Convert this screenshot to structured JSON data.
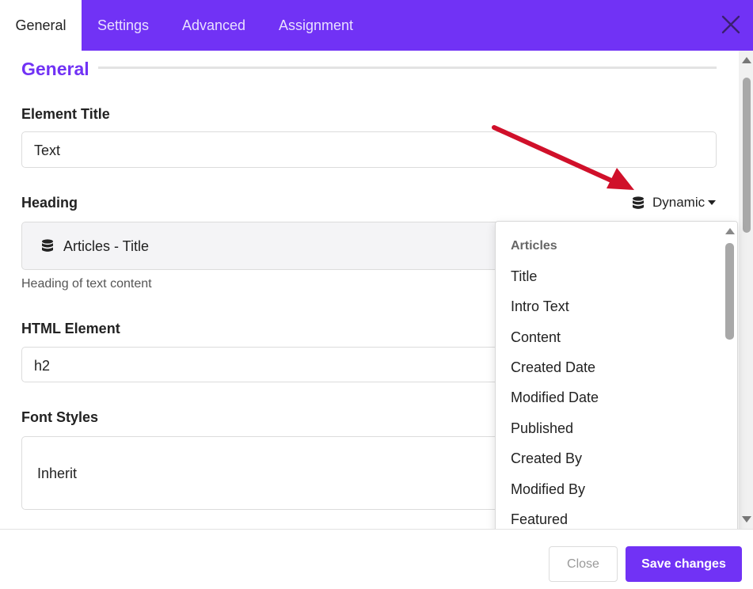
{
  "tabs": [
    {
      "label": "General",
      "active": true
    },
    {
      "label": "Settings"
    },
    {
      "label": "Advanced"
    },
    {
      "label": "Assignment"
    }
  ],
  "colors": {
    "accent": "#7132f5",
    "annotation_arrow": "#d0102a"
  },
  "icons": {
    "close": "close-icon",
    "database": "database-icon",
    "caret": "caret-down-icon"
  },
  "section": {
    "title": "General"
  },
  "fields": {
    "element_title": {
      "label": "Element Title",
      "value": "Text"
    },
    "heading": {
      "label": "Heading",
      "value": "Articles - Title",
      "help": "Heading of text content",
      "dynamic_label": "Dynamic"
    },
    "html_element": {
      "label": "HTML Element",
      "value": "h2"
    },
    "font_styles": {
      "label": "Font Styles",
      "value": "Inherit"
    }
  },
  "dynamic_menu": {
    "group": "Articles",
    "items": [
      "Title",
      "Intro Text",
      "Content",
      "Created Date",
      "Modified Date",
      "Published",
      "Created By",
      "Modified By",
      "Featured"
    ]
  },
  "footer": {
    "close_label": "Close",
    "save_label": "Save changes"
  }
}
